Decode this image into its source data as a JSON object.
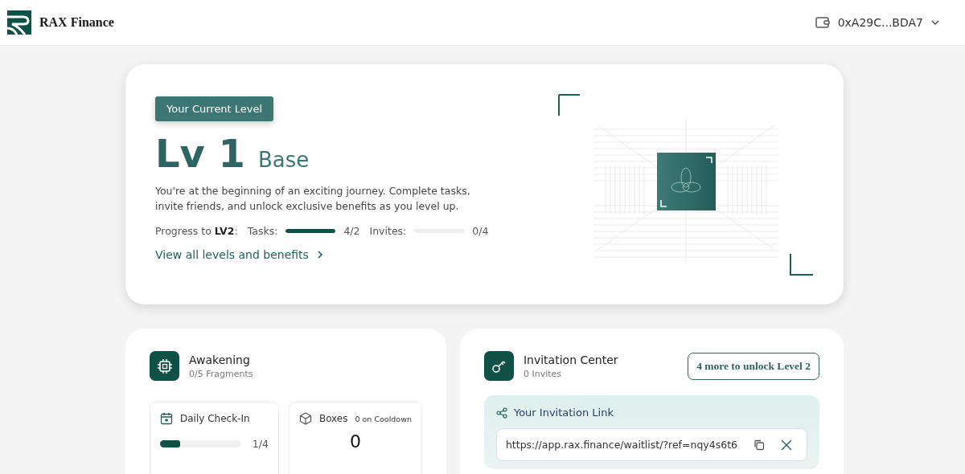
{
  "header": {
    "brand": "RAX Finance",
    "wallet": "0xA29C...BDA7"
  },
  "level_card": {
    "badge": "Your Current Level",
    "level": "Lv 1",
    "tier": "Base",
    "description": "You're at the beginning of an exciting journey. Complete tasks, invite friends, and unlock exclusive benefits as you level up.",
    "progress_label": "Progress to **LV2**:",
    "meters": [
      {
        "label": "Tasks:",
        "level": 1,
        "reading": "4/2"
      },
      {
        "label": "Invites:",
        "level": 0,
        "reading": "0/4"
      }
    ],
    "link": "View all levels and benefits"
  },
  "awakening": {
    "title": "Awakening",
    "subtitle": "0/5 Fragments",
    "check_in": {
      "title": "Daily Check-In",
      "level": 0.25,
      "reading": "1/4"
    },
    "boxes": {
      "title": "Boxes",
      "cooldown": "0 on Cooldown",
      "count": "0"
    }
  },
  "invitation": {
    "title": "Invitation Center",
    "subtitle": "0 Invites",
    "unlock_button": "4 more to unlock Level 2",
    "link_title": "Your Invitation Link",
    "link_value": "https://app.rax.finance/waitlist/?ref=nqy4s6t6"
  }
}
